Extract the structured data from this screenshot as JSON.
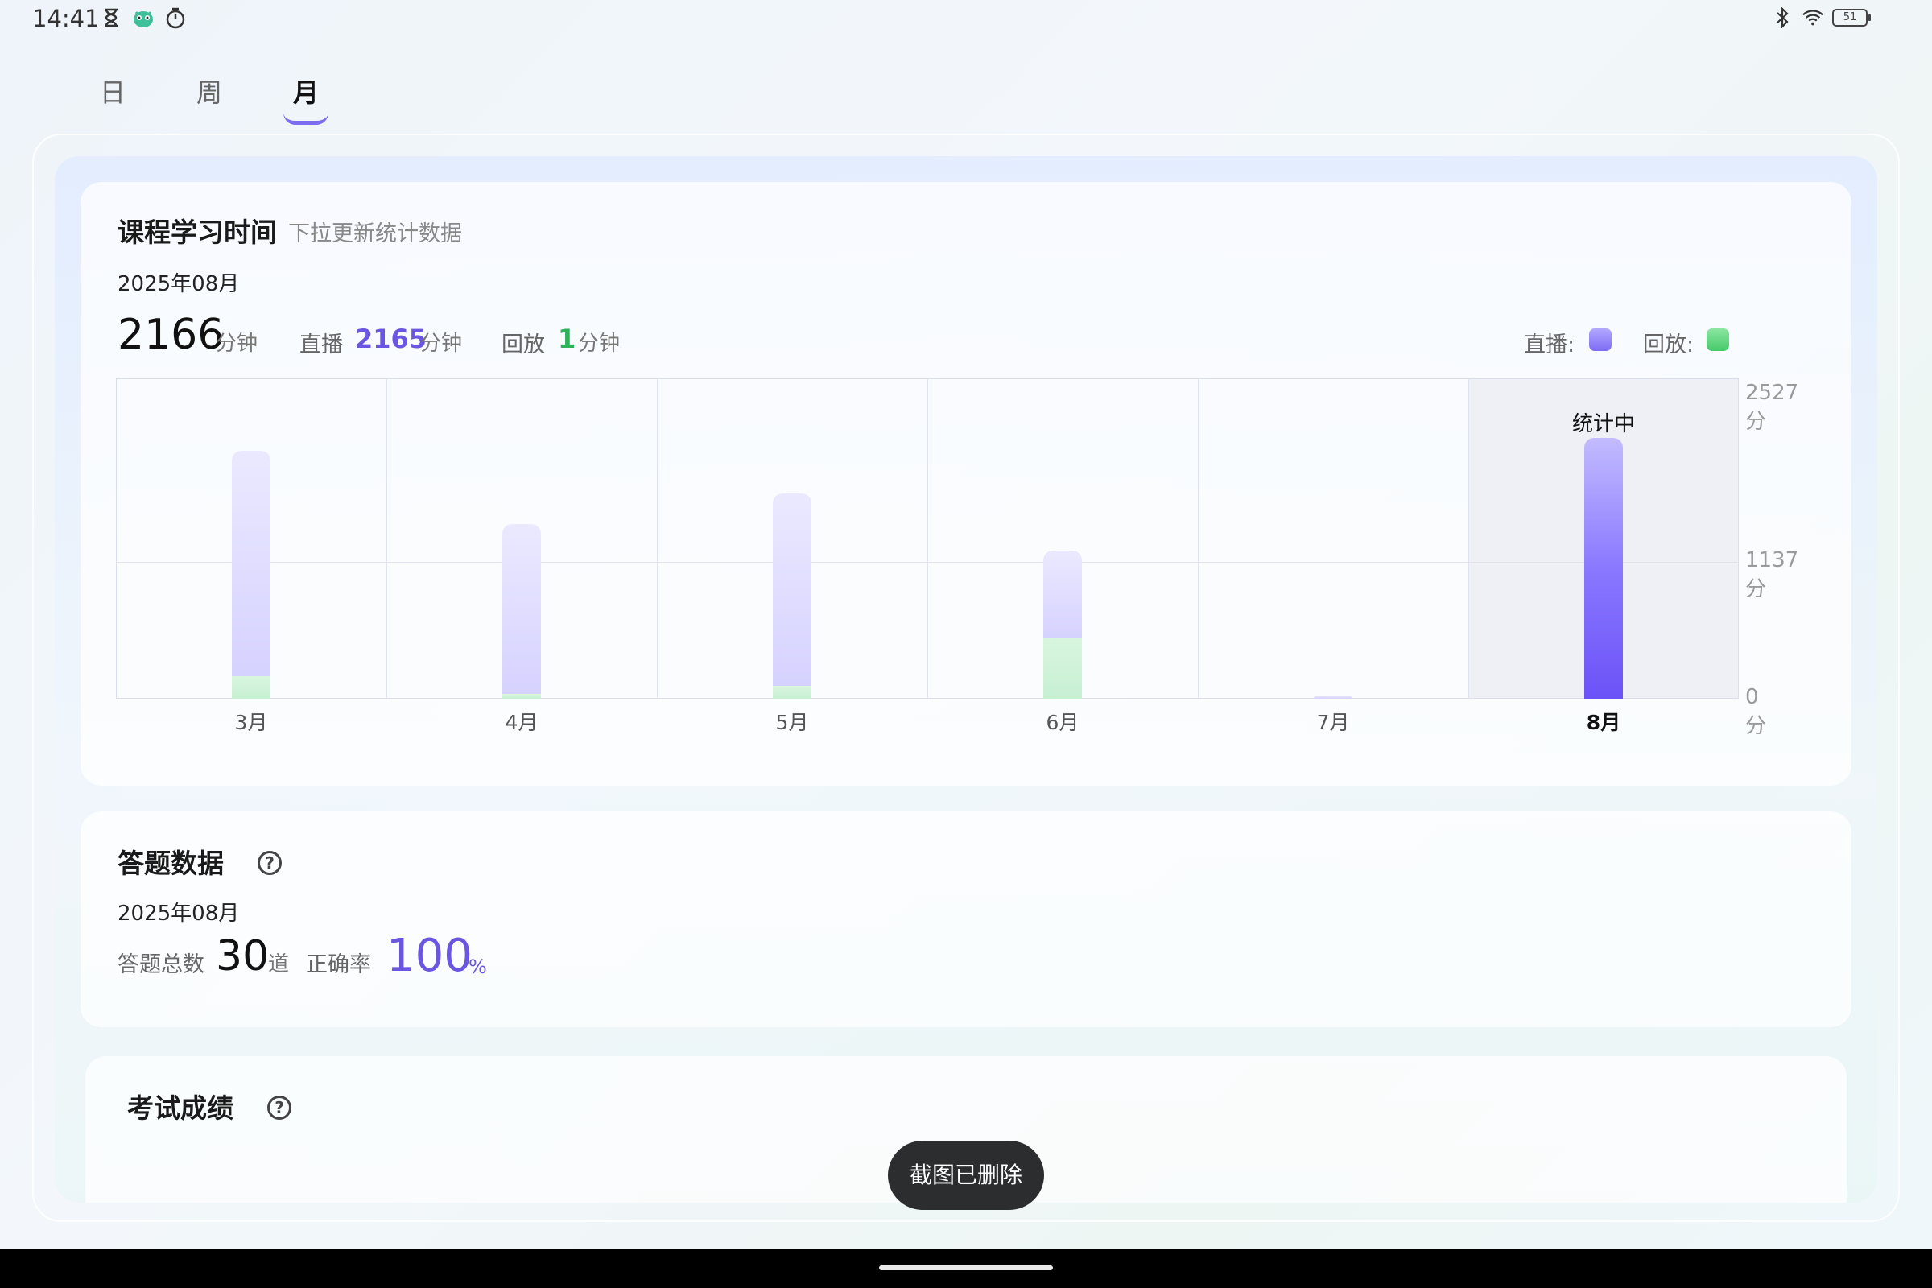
{
  "status_bar": {
    "time": "14:41",
    "left_icons": [
      "hourglass-icon",
      "mascot-icon",
      "timer-icon"
    ],
    "right_icons": [
      "bluetooth-icon",
      "wifi-icon",
      "battery-icon"
    ],
    "battery_level": "51"
  },
  "tabs": [
    {
      "label": "日",
      "active": false
    },
    {
      "label": "周",
      "active": false
    },
    {
      "label": "月",
      "active": true
    }
  ],
  "study_card": {
    "title": "课程学习时间",
    "subtitle": "下拉更新统计数据",
    "date": "2025年08月",
    "total_value": "2166",
    "total_unit": "分钟",
    "live_label": "直播",
    "live_value": "2165",
    "live_unit": "分钟",
    "replay_label": "回放",
    "replay_value": "1",
    "replay_unit": "分钟",
    "legend_live": "直播:",
    "legend_replay": "回放:",
    "colors": {
      "live": "#8a78ff",
      "replay": "#5fd37a"
    }
  },
  "chart_data": {
    "type": "bar",
    "stacked": true,
    "categories": [
      "3月",
      "4月",
      "5月",
      "6月",
      "7月",
      "8月"
    ],
    "series": [
      {
        "name": "直播",
        "values": [
          1868,
          1409,
          1593,
          718,
          10,
          2165
        ]
      },
      {
        "name": "回放",
        "values": [
          190,
          40,
          110,
          510,
          0,
          1
        ]
      }
    ],
    "yticks": [
      "2527分",
      "1137分",
      "0分"
    ],
    "ylim": [
      0,
      2527
    ],
    "current_category": "8月",
    "current_badge": "统计中",
    "grid": true
  },
  "answer_card": {
    "title": "答题数据",
    "date": "2025年08月",
    "total_label": "答题总数",
    "total_value": "30",
    "total_unit": "道",
    "accuracy_label": "正确率",
    "accuracy_value": "100",
    "accuracy_unit": "%"
  },
  "exam_card": {
    "title": "考试成绩"
  },
  "toast": {
    "text": "截图已删除"
  }
}
